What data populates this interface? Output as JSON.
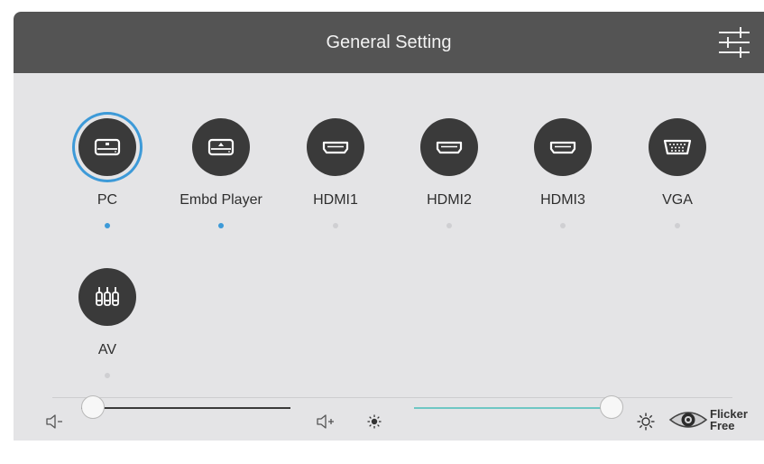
{
  "header": {
    "title": "General Setting",
    "settings_icon": "sliders-icon"
  },
  "colors": {
    "selected": "#3d9ad8",
    "inactive_dot": "#cfcfd2",
    "slider_fill": "#6fc7c4",
    "slider_track": "#3a3a3a"
  },
  "sources": [
    {
      "label": "PC",
      "icon": "pc-drive-icon",
      "selected": true,
      "active": true
    },
    {
      "label": "Embd Player",
      "icon": "player-drive-icon",
      "selected": false,
      "active": true
    },
    {
      "label": "HDMI1",
      "icon": "hdmi-icon",
      "selected": false,
      "active": false
    },
    {
      "label": "HDMI2",
      "icon": "hdmi-icon",
      "selected": false,
      "active": false
    },
    {
      "label": "HDMI3",
      "icon": "hdmi-icon",
      "selected": false,
      "active": false
    },
    {
      "label": "VGA",
      "icon": "vga-icon",
      "selected": false,
      "active": false
    },
    {
      "label": "AV",
      "icon": "av-icon",
      "selected": false,
      "active": false
    }
  ],
  "controls": {
    "volume": {
      "value": 0,
      "down_icon": "volume-down-icon",
      "up_icon": "volume-up-icon"
    },
    "brightness": {
      "value": 100,
      "low_icon": "brightness-low-icon",
      "high_icon": "brightness-high-icon"
    },
    "flicker_free": {
      "line1": "Flicker",
      "line2": "Free",
      "icon": "eye-icon"
    }
  }
}
